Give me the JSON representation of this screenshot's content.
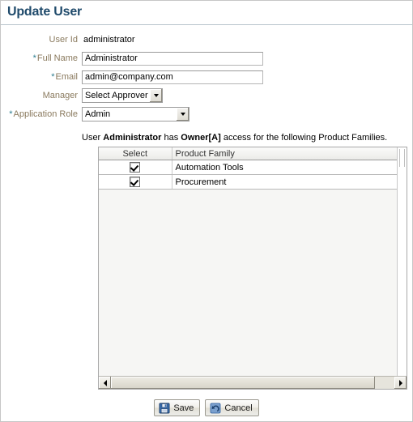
{
  "header": {
    "title": "Update User"
  },
  "form": {
    "user_id": {
      "label": "User Id",
      "value": "administrator",
      "required": false
    },
    "full_name": {
      "label": "Full Name",
      "value": "Administrator",
      "required": true,
      "star": "*"
    },
    "email": {
      "label": "Email",
      "value": "admin@company.com",
      "required": true,
      "star": "*"
    },
    "manager": {
      "label": "Manager",
      "value": "Select Approver",
      "required": false
    },
    "application_role": {
      "label": "Application Role",
      "value": "Admin",
      "required": true,
      "star": "*"
    }
  },
  "access": {
    "prefix": "User ",
    "user_name": "Administrator",
    "mid": " has ",
    "role": "Owner[A]",
    "suffix": " access for the following Product Families."
  },
  "table": {
    "columns": [
      "Select",
      "Product Family"
    ],
    "rows": [
      {
        "selected": true,
        "product_family": "Automation Tools"
      },
      {
        "selected": true,
        "product_family": "Procurement"
      }
    ]
  },
  "footer": {
    "save_label": "Save",
    "cancel_label": "Cancel"
  },
  "colors": {
    "title": "#1f4a6b",
    "label": "#8a7a5e",
    "required_star": "#2d7d8f",
    "page_border": "#c6c6c6",
    "table_border": "#a8a8a8",
    "table_body_bg": "#f6f6f4",
    "icon_blue": "#2f5f9e"
  }
}
